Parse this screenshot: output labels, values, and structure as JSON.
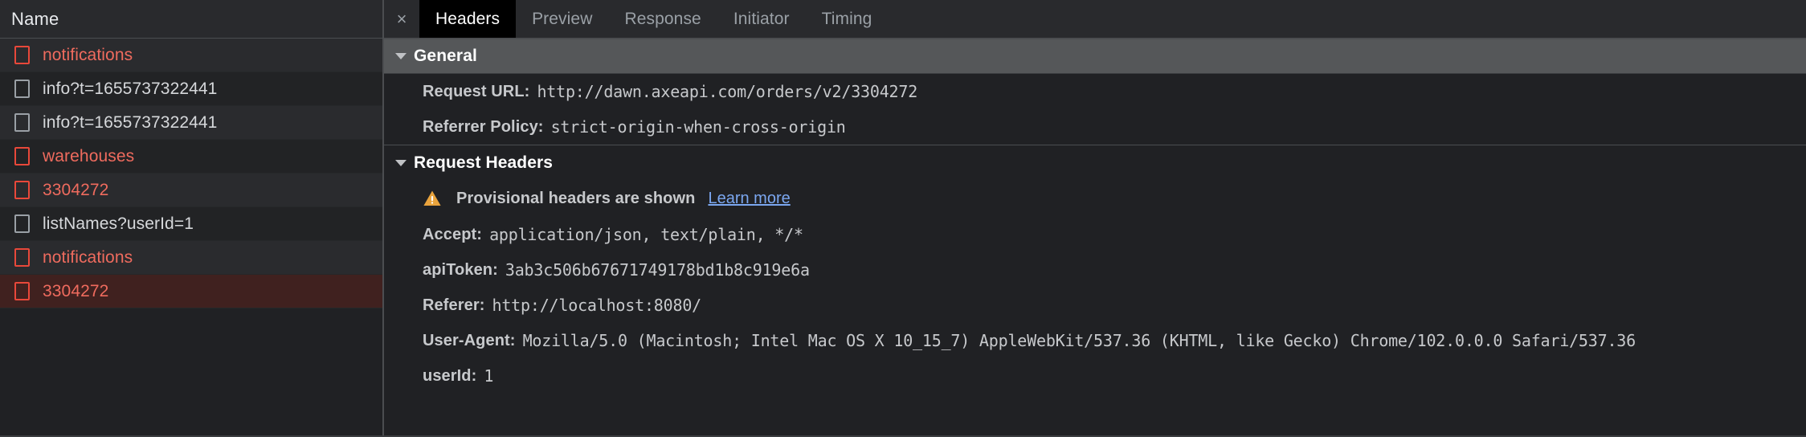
{
  "request_list": {
    "column_header": "Name",
    "rows": [
      {
        "name": "notifications",
        "status": "error",
        "selected": false
      },
      {
        "name": "info?t=1655737322441",
        "status": "normal",
        "selected": false
      },
      {
        "name": "info?t=1655737322441",
        "status": "normal",
        "selected": false
      },
      {
        "name": "warehouses",
        "status": "error",
        "selected": false
      },
      {
        "name": "3304272",
        "status": "error",
        "selected": false
      },
      {
        "name": "listNames?userId=1",
        "status": "normal",
        "selected": false
      },
      {
        "name": "notifications",
        "status": "error",
        "selected": false
      },
      {
        "name": "3304272",
        "status": "error",
        "selected": true
      }
    ]
  },
  "detail_panel": {
    "close_glyph": "×",
    "tabs": [
      {
        "label": "Headers",
        "active": true
      },
      {
        "label": "Preview",
        "active": false
      },
      {
        "label": "Response",
        "active": false
      },
      {
        "label": "Initiator",
        "active": false
      },
      {
        "label": "Timing",
        "active": false
      }
    ],
    "general": {
      "title": "General",
      "rows": [
        {
          "key": "Request URL:",
          "value": "http://dawn.axeapi.com/orders/v2/3304272"
        },
        {
          "key": "Referrer Policy:",
          "value": "strict-origin-when-cross-origin"
        }
      ]
    },
    "request_headers": {
      "title": "Request Headers",
      "warning": {
        "icon": "warning-triangle-icon",
        "text": "Provisional headers are shown",
        "link_label": "Learn more"
      },
      "rows": [
        {
          "key": "Accept:",
          "value": "application/json, text/plain, */*"
        },
        {
          "key": "apiToken:",
          "value": "3ab3c506b67671749178bd1b8c919e6a"
        },
        {
          "key": "Referer:",
          "value": "http://localhost:8080/"
        },
        {
          "key": "User-Agent:",
          "value": "Mozilla/5.0 (Macintosh; Intel Mac OS X 10_15_7) AppleWebKit/537.36 (KHTML, like Gecko) Chrome/102.0.0.0 Safari/537.36"
        },
        {
          "key": "userId:",
          "value": "1"
        }
      ]
    }
  },
  "colors": {
    "background": "#202124",
    "panel_header": "#292a2d",
    "error_red": "#ef6b5e",
    "selected_row": "#40211f",
    "link_blue": "#7ba7f0",
    "warning_amber": "#e8a33d",
    "section_shade": "#555759"
  }
}
